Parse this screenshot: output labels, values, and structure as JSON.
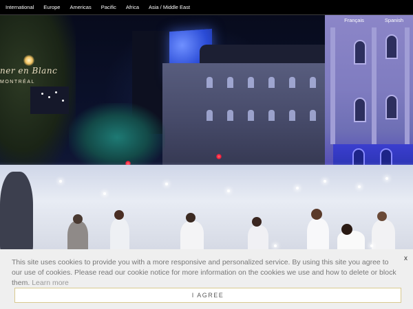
{
  "nav": {
    "items": [
      {
        "label": "International"
      },
      {
        "label": "Europe"
      },
      {
        "label": "Americas"
      },
      {
        "label": "Pacific"
      },
      {
        "label": "Africa"
      },
      {
        "label": "Asia / Middle East"
      }
    ]
  },
  "languages": [
    {
      "label": "Français"
    },
    {
      "label": "Spanish"
    }
  ],
  "logo": {
    "script": "ner en Blanc",
    "city": "MONTRÉAL"
  },
  "hero": {
    "image_subject": "night-street-white-dinner-crowd"
  },
  "cookie": {
    "text": "This site uses cookies to provide you with a more responsive and personalized service. By using this site you agree to our use of cookies. Please read our cookie notice for more information on the cookies we use and how to delete or block them.",
    "link_label": "Learn more",
    "close_label": "x",
    "agree_label": "I AGREE"
  },
  "colors": {
    "nav_bg": "#000000",
    "banner_bg": "#efefef",
    "agree_border": "#d8c98f",
    "building_glow": "#3b3ecf"
  }
}
